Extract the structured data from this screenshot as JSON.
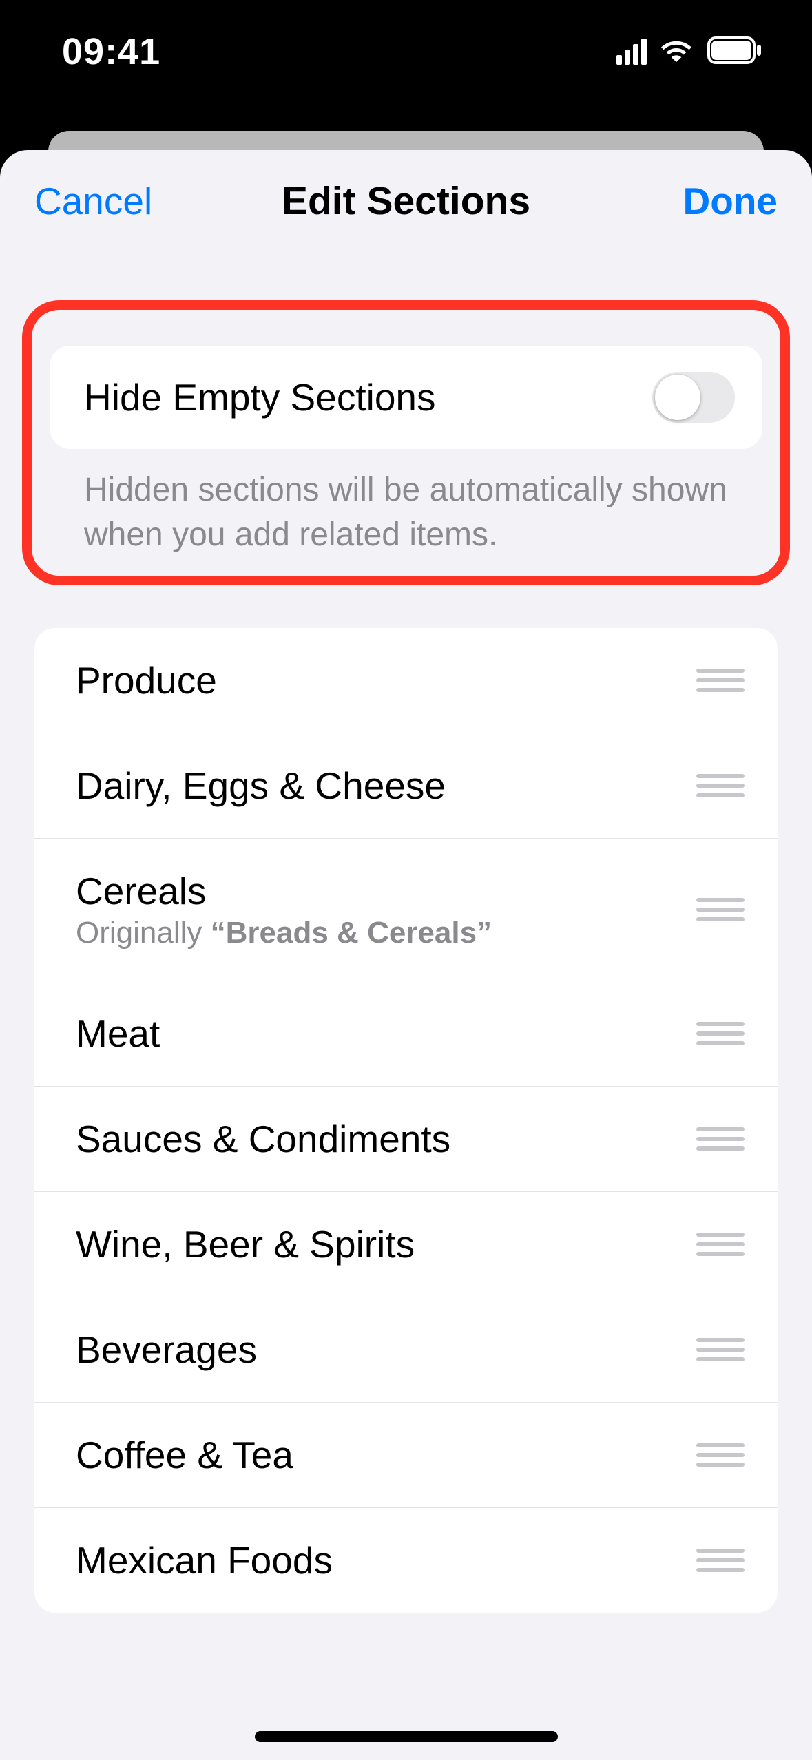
{
  "status": {
    "time": "09:41"
  },
  "nav": {
    "cancel": "Cancel",
    "title": "Edit Sections",
    "done": "Done"
  },
  "toggle": {
    "label": "Hide Empty Sections",
    "footer": "Hidden sections will be automatically shown when you add related items."
  },
  "sections": [
    {
      "label": "Produce"
    },
    {
      "label": "Dairy, Eggs & Cheese"
    },
    {
      "label": "Cereals",
      "sub_prefix": "Originally ",
      "sub_quoted": "“Breads & Cereals”"
    },
    {
      "label": "Meat"
    },
    {
      "label": "Sauces & Condiments"
    },
    {
      "label": "Wine, Beer & Spirits"
    },
    {
      "label": "Beverages"
    },
    {
      "label": "Coffee & Tea"
    },
    {
      "label": "Mexican Foods"
    }
  ]
}
